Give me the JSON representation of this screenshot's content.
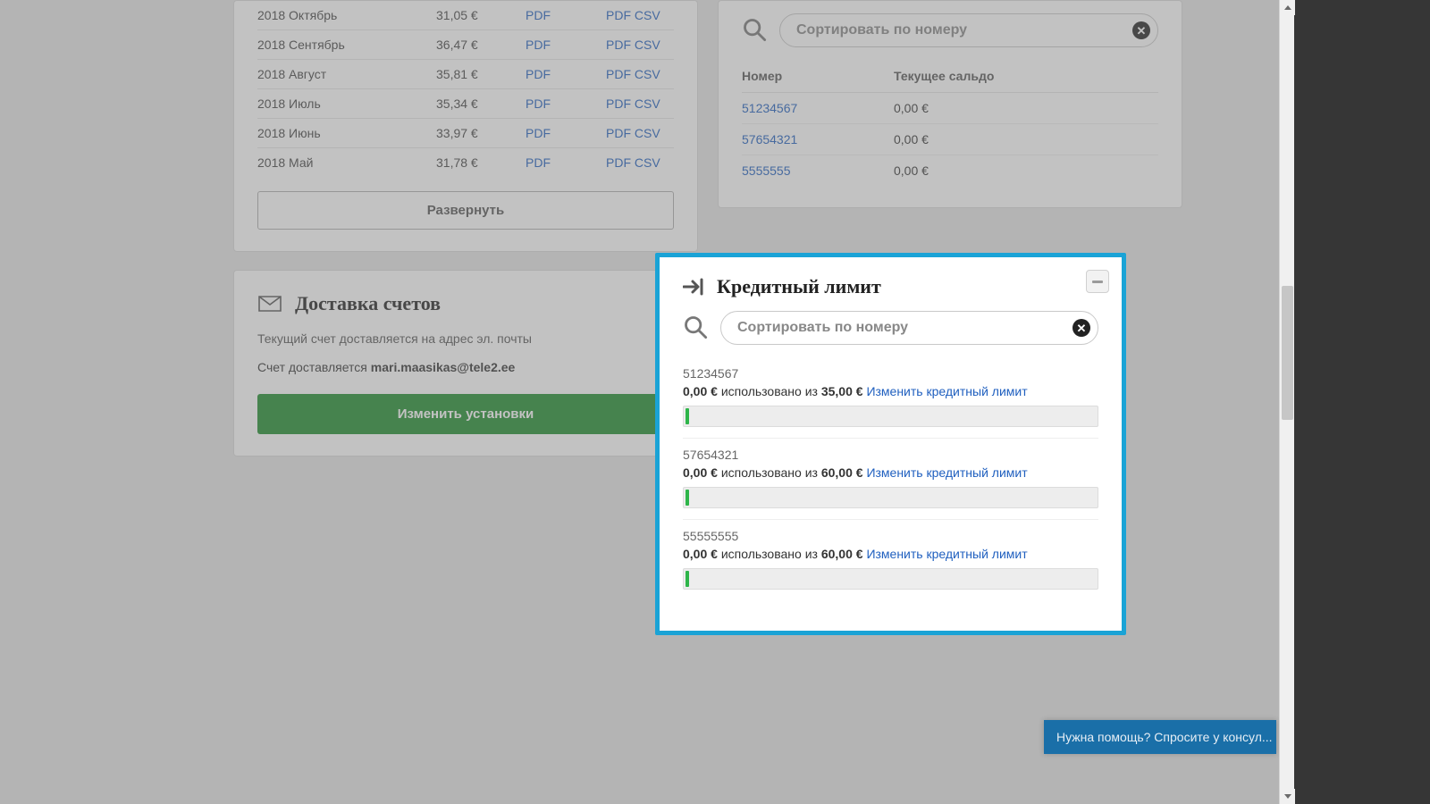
{
  "invoices": {
    "rows": [
      {
        "month": "2018 Октябрь",
        "amount": "31,05 €",
        "pdf": "PDF",
        "det_pdf": "PDF",
        "det_csv": "CSV"
      },
      {
        "month": "2018 Сентябрь",
        "amount": "36,47 €",
        "pdf": "PDF",
        "det_pdf": "PDF",
        "det_csv": "CSV"
      },
      {
        "month": "2018 Август",
        "amount": "35,81 €",
        "pdf": "PDF",
        "det_pdf": "PDF",
        "det_csv": "CSV"
      },
      {
        "month": "2018 Июль",
        "amount": "35,34 €",
        "pdf": "PDF",
        "det_pdf": "PDF",
        "det_csv": "CSV"
      },
      {
        "month": "2018 Июнь",
        "amount": "33,97 €",
        "pdf": "PDF",
        "det_pdf": "PDF",
        "det_csv": "CSV"
      },
      {
        "month": "2018 Май",
        "amount": "31,78 €",
        "pdf": "PDF",
        "det_pdf": "PDF",
        "det_csv": "CSV"
      }
    ],
    "expand": "Развернуть"
  },
  "delivery": {
    "title": "Доставка счетов",
    "line1": "Текущий счет доставляется на адрес эл. почты",
    "line2_prefix": "Счет доставляется ",
    "email": "mari.maasikas@tele2.ee",
    "button": "Изменить установки"
  },
  "balances": {
    "search_placeholder": "Сортировать по номеру",
    "col_number": "Номер",
    "col_balance": "Текущее сальдо",
    "rows": [
      {
        "num": "51234567",
        "bal": "0,00 €"
      },
      {
        "num": "57654321",
        "bal": "0,00 €"
      },
      {
        "num": "5555555",
        "bal": "0,00 €"
      }
    ]
  },
  "credit": {
    "title": "Кредитный лимит",
    "search_placeholder": "Сортировать по номеру",
    "used_word": "использовано из",
    "change_link": "Изменить кредитный лимит",
    "items": [
      {
        "num": "51234567",
        "used": "0,00 €",
        "limit": "35,00 €"
      },
      {
        "num": "57654321",
        "used": "0,00 €",
        "limit": "60,00 €"
      },
      {
        "num": "55555555",
        "used": "0,00 €",
        "limit": "60,00 €"
      }
    ]
  },
  "help_widget": "Нужна помощь? Спросите у консул..."
}
